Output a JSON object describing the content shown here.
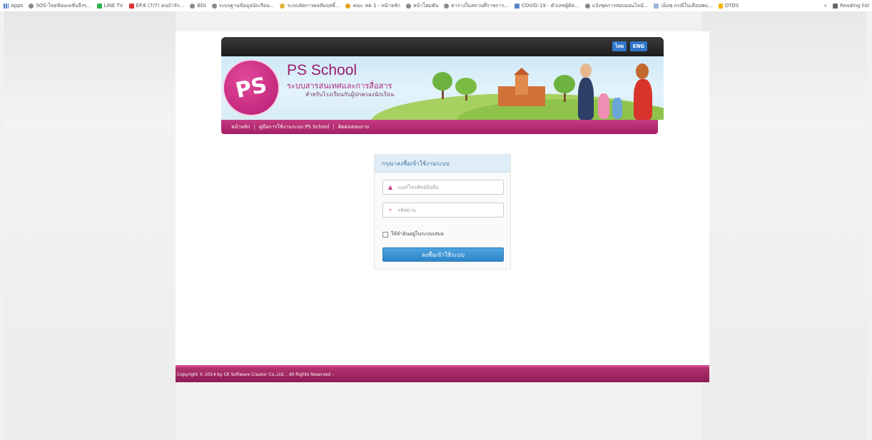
{
  "bookmarks_bar": {
    "items": [
      {
        "label": "Apps",
        "icon": "apps-grid-icon"
      },
      {
        "label": "SOS-ไทยช้อมเคชั่นจีงๆ...",
        "icon": "globe-icon"
      },
      {
        "label": "LINE TV",
        "icon": "line-tv-icon"
      },
      {
        "label": "EP.6 (7/7) คนบ้ารัก...",
        "icon": "youtube-icon"
      },
      {
        "label": "BDI",
        "icon": "globe-icon"
      },
      {
        "label": "ระบบฐานข้อมูลนักเรียน...",
        "icon": "globe-icon"
      },
      {
        "label": "ระบบจัดการผลสัมฤทธิ์...",
        "icon": "globe-icon"
      },
      {
        "label": "คณะ ทต 1 - หน้าหลัก",
        "icon": "globe-icon"
      },
      {
        "label": "หน้าโฮมพัน",
        "icon": "globe-icon"
      },
      {
        "label": "ตารางในสถานที่ราชการ...",
        "icon": "globe-icon"
      },
      {
        "label": "COVID-19 - ตัวเลขผู้ติด...",
        "icon": "folder-icon"
      },
      {
        "label": "แจ้งชุดการสอบออนไลน์...",
        "icon": "globe-icon"
      },
      {
        "label": "เอ็มพุ กรณีในเดือนพฤ...",
        "icon": "folder-icon"
      },
      {
        "label": "OTDS",
        "icon": "drive-icon"
      }
    ],
    "more": "»",
    "reading_list": "Reading list"
  },
  "header": {
    "lang_th": "ไทย",
    "lang_en": "ENG",
    "logo_text": "PS",
    "site_title": "PS School",
    "site_subtitle": "ระบบสารสนเทศและการสื่อสาร",
    "site_tagline": "สำหรับโรงเรียนกับผู้ปกครองนักเรียน"
  },
  "nav": {
    "items": [
      "หน้าหลัก",
      "คู่มือการใช้งานระบบ PS School",
      "ติดต่อสอบถาม"
    ],
    "separator": "|"
  },
  "login": {
    "heading": "กรุณาลงชื่อเข้าใช้งานระบบ",
    "username_placeholder": "เบอร์โทรศัพท์มือถือ",
    "password_placeholder": "รหัสผ่าน",
    "remember_label": "ให้จำฉันอยู่ในระบบเสมอ",
    "submit_label": "ลงชื่อเข้าใช้ระบบ"
  },
  "footer": {
    "copyright": "Copyright © 2014 by CK Software Creator Co.,Ltd. , All Rights Reserved –"
  },
  "colors": {
    "brand_magenta": "#a51f66",
    "login_button": "#2e86c9",
    "topbar": "#1d1d1d"
  }
}
